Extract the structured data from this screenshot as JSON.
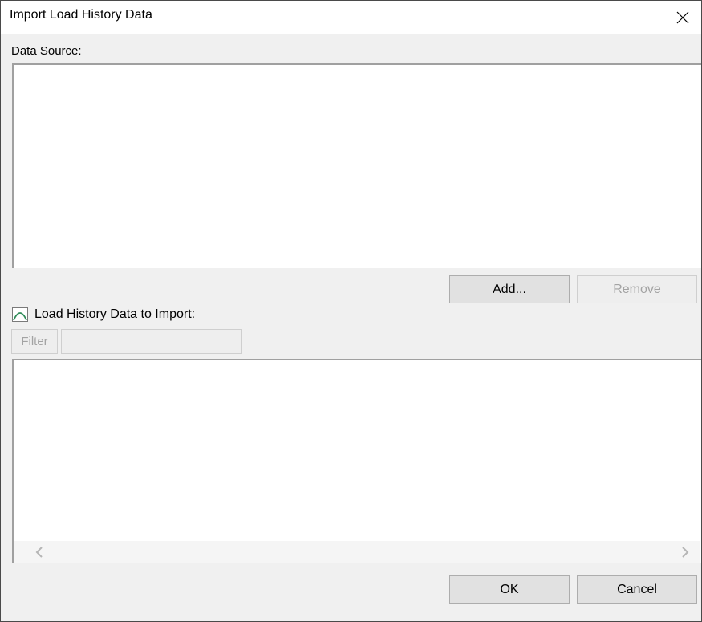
{
  "window": {
    "title": "Import Load History Data"
  },
  "data_source": {
    "label": "Data Source:",
    "add_button": "Add...",
    "remove_button": "Remove"
  },
  "load_history": {
    "label": "Load History Data to Import:",
    "filter_button": "Filter",
    "filter_value": ""
  },
  "footer": {
    "ok_button": "OK",
    "cancel_button": "Cancel"
  },
  "icons": {
    "close": "close-icon",
    "load_history": "load-curve-icon",
    "scroll_left": "chevron-left-icon",
    "scroll_right": "chevron-right-icon"
  },
  "colors": {
    "icon_green": "#2e8b57",
    "disabled_text": "#a3a3a3"
  }
}
